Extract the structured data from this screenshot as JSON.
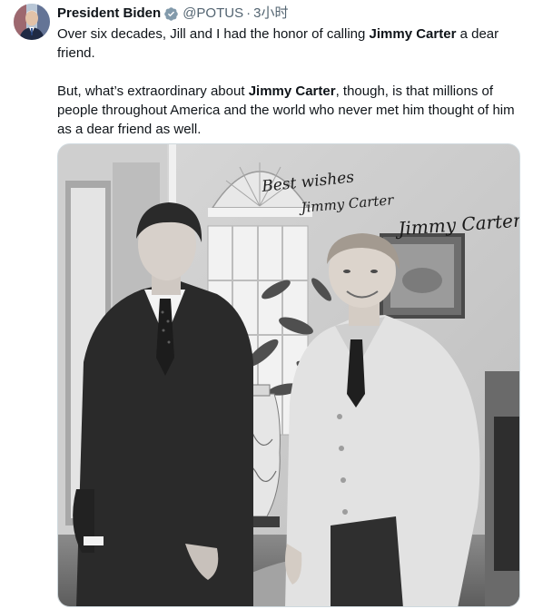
{
  "author": {
    "name": "President Biden",
    "handle": "@POTUS",
    "separator": "·",
    "time": "3小时",
    "verified_badge": "verified-badge-icon",
    "verified_color": "#829aab"
  },
  "tweet": {
    "para1": {
      "before": "Over six decades, Jill and I had the honor of calling ",
      "bold": "Jimmy Carter",
      "after": " a dear friend."
    },
    "para2": {
      "before": "But, what’s extraordinary about ",
      "bold": "Jimmy Carter",
      "after": ", though, is that millions of people throughout America and the world who never met him thought of him as a dear friend as well."
    }
  },
  "photo": {
    "inscription": {
      "line1": "Best wishes",
      "line2": "Jimmy Carter"
    },
    "signature": "Jimmy Carter",
    "style": "black-and-white"
  },
  "colors": {
    "text": "#0f1419",
    "secondary": "#536471",
    "border": "#cfd9de"
  }
}
